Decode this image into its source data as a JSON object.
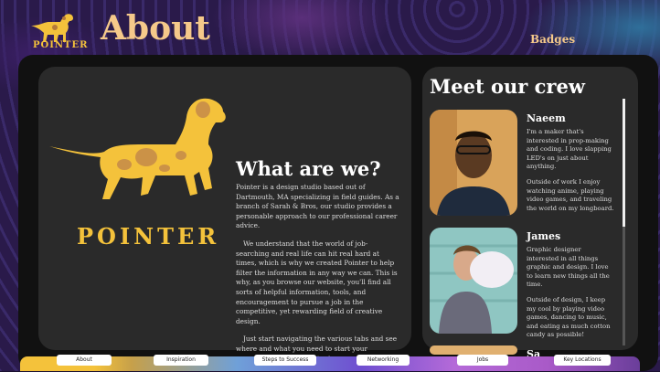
{
  "header": {
    "brand": "POINTER",
    "title": "About",
    "badges_link": "Badges"
  },
  "about": {
    "brand_word": "POINTER",
    "heading": "What are we?",
    "paragraphs": [
      "Pointer is a design studio based out of Dartmouth, MA specializing in field guides. As a branch of Sarah & Bros, our studio provides a personable approach to our professional career advice.",
      "We understand that the world of job-searching and real life can hit real hard at times, which is why we created Pointer to help filter the information in any way we can. This is why, as you browse our website, you'll find all sorts of helpful information, tools, and encouragement to pursue a job in the competitive, yet rewarding field of creative design.",
      "Just start navigating the various tabs and see where and what you need to start your successful career in design!"
    ]
  },
  "crew": {
    "heading": "Meet our crew",
    "members": [
      {
        "name": "Naeem",
        "bio": [
          "I'm a maker that's interested in prop-making and coding. I love slapping LED's on just about anything.",
          "Outside of work I enjoy watching anime, playing video games, and traveling the world on my longboard."
        ]
      },
      {
        "name": "James",
        "bio": [
          "Graphic designer interested in all things graphic and design. I love to learn new things all the time.",
          "Outside of design, I keep my cool by playing video games, dancing to music, and eating as much cotton candy as possible!"
        ]
      },
      {
        "name": "Sa"
      }
    ]
  },
  "tabs": [
    "About",
    "Inspiration",
    "Steps to Success",
    "Networking",
    "Jobs",
    "Key Locations"
  ],
  "colors": {
    "accent": "#f4c23b",
    "title": "#f5c98a",
    "panel": "#2a2a2a"
  }
}
